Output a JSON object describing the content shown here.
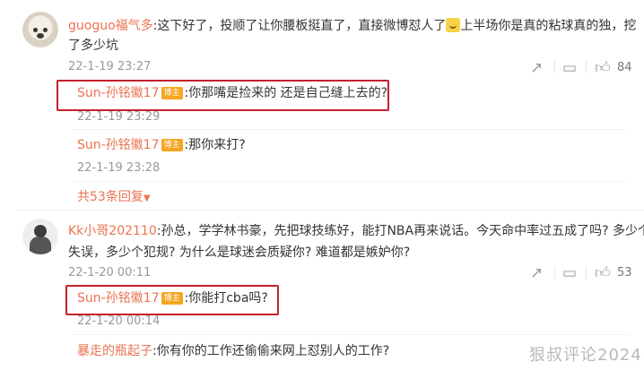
{
  "comments": [
    {
      "user": "guoguo福气多",
      "text_line1": ":这下好了，投顺了让你腰板挺直了，直接微博怼人了",
      "text_line1b": "上半场你是真的粘球真的独，挖",
      "text_line2": "了多少坑",
      "time": "22-1-19 23:27",
      "likes": "84",
      "replies": [
        {
          "user": "Sun-孙铭徽17",
          "badge": "博主",
          "text": ":你那嘴是捡来的 还是自己缝上去的?",
          "time": "22-1-19 23:29"
        },
        {
          "user": "Sun-孙铭徽17",
          "badge": "博主",
          "text": ":那你来打?",
          "time": "22-1-19 23:28"
        }
      ],
      "more_replies": "共53条回复"
    },
    {
      "user": "Kk小哥202110",
      "text_line1": ":孙总，学学林书豪，先把球技练好，能打NBA再来说话。今天命中率过五成了吗? 多少个",
      "text_line2": "失误，多少个犯规? 为什么是球迷会质疑你? 难道都是嫉妒你?",
      "time": "22-1-20 00:11",
      "likes": "53",
      "replies": [
        {
          "user": "Sun-孙铭徽17",
          "badge": "博主",
          "text": ":你能打cba吗?",
          "time": "22-1-20 00:14"
        },
        {
          "user": "暴走的瓶起子",
          "text": ":你有你的工作还偷偷来网上怼别人的工作?"
        }
      ]
    }
  ],
  "watermark": "狠叔评论2024",
  "icons": {
    "share": "share-icon",
    "comment": "comment-icon",
    "like": "thumbs-up-icon",
    "caret": "caret-down-icon"
  }
}
